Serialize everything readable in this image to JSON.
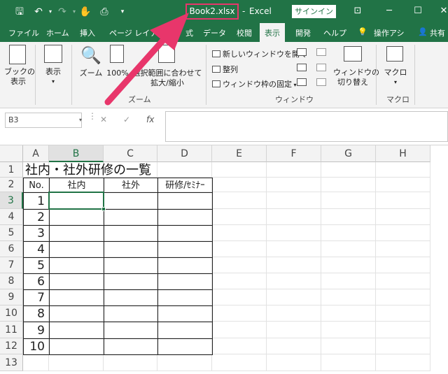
{
  "titlebar": {
    "file_name": "Book2.xlsx",
    "separator": "-",
    "app_name": "Excel",
    "signin_label": "サインイン"
  },
  "ribbon_tabs": [
    "ファイル",
    "ホーム",
    "挿入",
    "ページ レイアウト",
    "式",
    "データ",
    "校閲",
    "表示",
    "開発",
    "ヘルプ",
    "操作アシ",
    "共有"
  ],
  "ribbon": {
    "book_view_line1": "ブックの",
    "book_view_line2": "表示",
    "show_label": "表示",
    "zoom_label": "ズーム",
    "zoom100_label": "100%",
    "zoom_selection_line1": "選択範囲に合わせて",
    "zoom_selection_line2": "拡大/縮小",
    "zoom_group": "ズーム",
    "new_window": "新しいウィンドウを開く",
    "arrange": "整列",
    "freeze_panes": "ウィンドウ枠の固定",
    "switch_line1": "ウィンドウの",
    "switch_line2": "切り替え",
    "window_group": "ウィンドウ",
    "macro_label": "マクロ",
    "macro_group": "マクロ"
  },
  "formula_bar": {
    "name_box": "B3",
    "cancel_symbol": "✕",
    "enter_symbol": "✓",
    "fx_symbol": "fx",
    "formula": ""
  },
  "sheet": {
    "columns": [
      "A",
      "B",
      "C",
      "D",
      "E",
      "F",
      "G",
      "H"
    ],
    "rows": [
      "1",
      "2",
      "3",
      "4",
      "5",
      "6",
      "7",
      "8",
      "9",
      "10",
      "11",
      "12",
      "13"
    ],
    "selected_column": "B",
    "selected_row": "3",
    "title": "社内・社外研修の一覧",
    "table_headers": [
      "No.",
      "社内",
      "社外",
      "研修/ｾﾐﾅｰ"
    ],
    "numbers": [
      "1",
      "2",
      "3",
      "4",
      "5",
      "6",
      "7",
      "8",
      "9",
      "10"
    ]
  },
  "colors": {
    "excel_green": "#217346",
    "highlight_pink": "#e8366b"
  }
}
